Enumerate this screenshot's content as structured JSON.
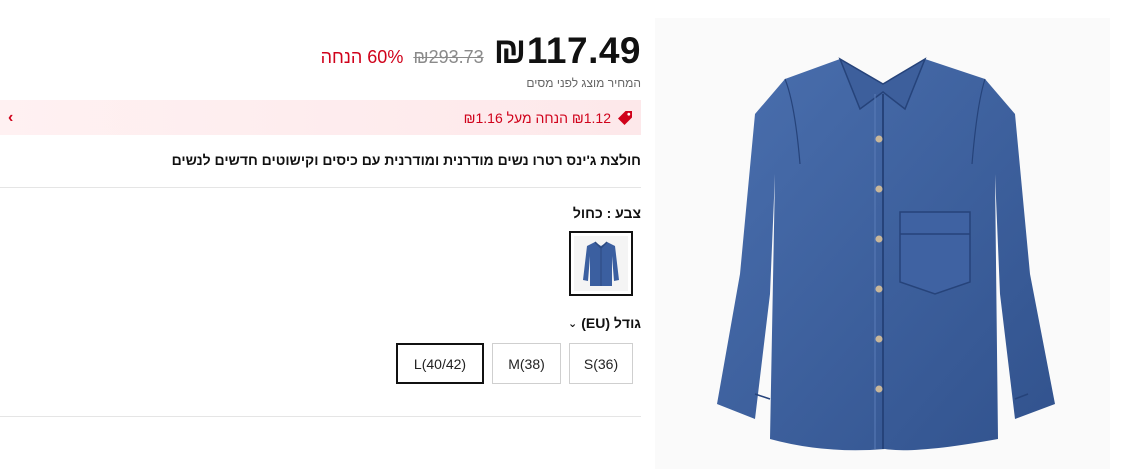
{
  "price": {
    "current": "₪117.49",
    "original": "₪293.73",
    "discount": "60% הנחה",
    "tax_note": "המחיר מוצג לפני מסים"
  },
  "promo": {
    "text": "₪1.12 הנחה מעל ₪1.16",
    "accent_color": "#d0021b"
  },
  "product": {
    "title": "חולצת ג'ינס רטרו נשים מודרנית ומודרנית עם כיסים וקישוטים חדשים לנשים",
    "image_icon": "denim-shirt-image"
  },
  "color": {
    "label": "צבע : כחול"
  },
  "size": {
    "label": "גודל (EU)",
    "options": [
      {
        "label": "S(36)",
        "selected": false
      },
      {
        "label": "M(38)",
        "selected": false
      },
      {
        "label": "L(40/42)",
        "selected": true
      }
    ]
  }
}
